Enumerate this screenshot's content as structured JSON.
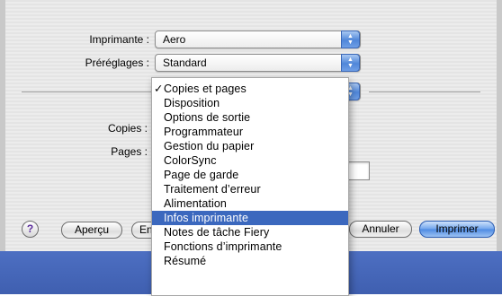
{
  "form": {
    "printer_label": "Imprimante :",
    "printer_value": "Aero",
    "presets_label": "Préréglages :",
    "presets_value": "Standard",
    "copies_label": "Copies :",
    "pages_label": "Pages :"
  },
  "menu": {
    "checked_index": 0,
    "selected_index": 10,
    "items": [
      "Copies et pages",
      "Disposition",
      "Options de sortie",
      "Programmateur",
      "Gestion du papier",
      "ColorSync",
      "Page de garde",
      "Traitement d’erreur",
      "Alimentation",
      "Infos imprimante",
      "Notes de tâche Fiery",
      "Fonctions d’imprimante",
      "Résumé"
    ]
  },
  "buttons": {
    "help": "?",
    "preview": "Aperçu",
    "save_partial": "En",
    "cancel": "Annuler",
    "print": "Imprimer"
  },
  "icons": {
    "popup_arrows": "up-down-arrows-icon",
    "check": "checkmark-icon",
    "help": "question-mark-icon"
  },
  "colors": {
    "accent": "#3b68be",
    "band": "#4a6cc0"
  }
}
